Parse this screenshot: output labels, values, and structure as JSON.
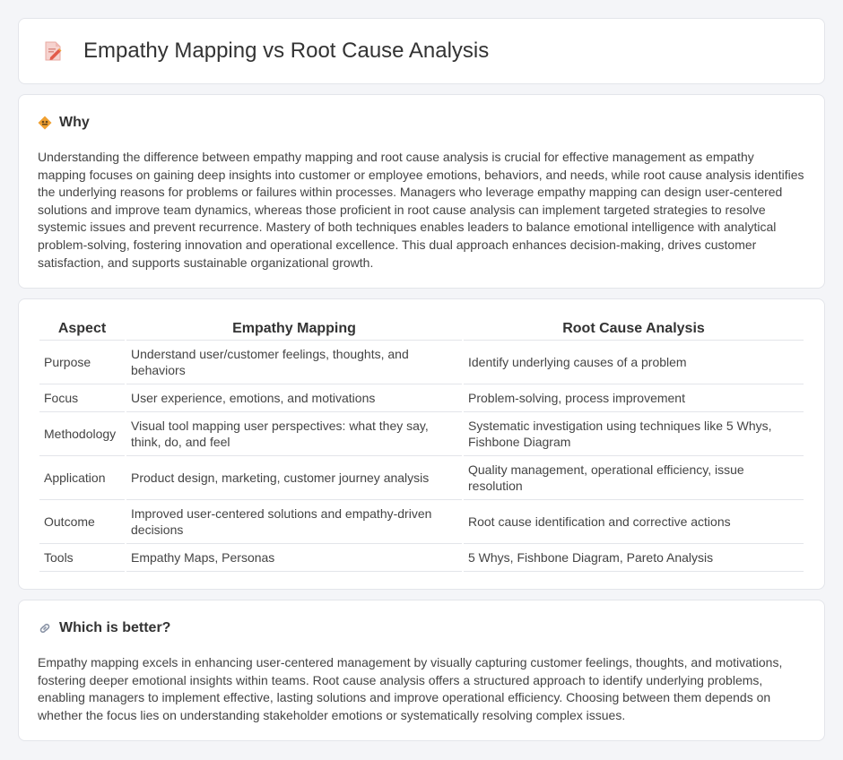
{
  "header": {
    "title": "Empathy Mapping vs Root Cause Analysis",
    "icon": "document-pencil-icon"
  },
  "why": {
    "title": "Why",
    "icon": "diamond-signpost-icon",
    "text": "Understanding the difference between empathy mapping and root cause analysis is crucial for effective management as empathy mapping focuses on gaining deep insights into customer or employee emotions, behaviors, and needs, while root cause analysis identifies the underlying reasons for problems or failures within processes. Managers who leverage empathy mapping can design user-centered solutions and improve team dynamics, whereas those proficient in root cause analysis can implement targeted strategies to resolve systemic issues and prevent recurrence. Mastery of both techniques enables leaders to balance emotional intelligence with analytical problem-solving, fostering innovation and operational excellence. This dual approach enhances decision-making, drives customer satisfaction, and supports sustainable organizational growth."
  },
  "table": {
    "headers": [
      "Aspect",
      "Empathy Mapping",
      "Root Cause Analysis"
    ],
    "rows": [
      [
        "Purpose",
        "Understand user/customer feelings, thoughts, and behaviors",
        "Identify underlying causes of a problem"
      ],
      [
        "Focus",
        "User experience, emotions, and motivations",
        "Problem-solving, process improvement"
      ],
      [
        "Methodology",
        "Visual tool mapping user perspectives: what they say, think, do, and feel",
        "Systematic investigation using techniques like 5 Whys, Fishbone Diagram"
      ],
      [
        "Application",
        "Product design, marketing, customer journey analysis",
        "Quality management, operational efficiency, issue resolution"
      ],
      [
        "Outcome",
        "Improved user-centered solutions and empathy-driven decisions",
        "Root cause identification and corrective actions"
      ],
      [
        "Tools",
        "Empathy Maps, Personas",
        "5 Whys, Fishbone Diagram, Pareto Analysis"
      ]
    ]
  },
  "which": {
    "title": "Which is better?",
    "icon": "link-icon",
    "text": "Empathy mapping excels in enhancing user-centered management by visually capturing customer feelings, thoughts, and motivations, fostering deeper emotional insights within teams. Root cause analysis offers a structured approach to identify underlying problems, enabling managers to implement effective, lasting solutions and improve operational efficiency. Choosing between them depends on whether the focus lies on understanding stakeholder emotions or systematically resolving complex issues."
  },
  "colors": {
    "accent_orange": "#f0a030",
    "pencil_red": "#e25b4a",
    "doc_pink": "#f3c6c2"
  }
}
